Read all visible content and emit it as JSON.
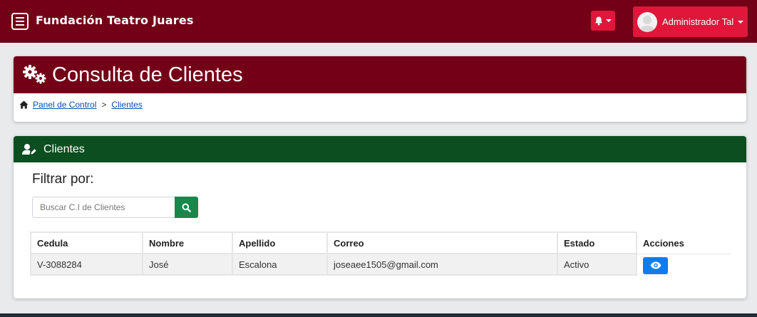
{
  "navbar": {
    "brand": "Fundación Teatro Juares",
    "user_name": "Administrador Tal",
    "menu_icon": "hamburger-menu-icon",
    "notifications_icon": "bell-icon",
    "colors": {
      "bar": "#730017",
      "button": "#e0163b"
    }
  },
  "page": {
    "title": "Consulta de Clientes",
    "title_icon": "gears-icon",
    "breadcrumb": {
      "home_icon": "home-icon",
      "items": [
        "Panel de Control",
        "Clientes"
      ],
      "separator": ">"
    }
  },
  "clients_panel": {
    "header": "Clientes",
    "header_icon": "user-edit-icon",
    "header_color": "#0c4e20",
    "filter_label": "Filtrar por:",
    "search": {
      "placeholder": "Buscar C.I de Clientes",
      "value": "",
      "button_icon": "search-icon",
      "button_color": "#17874a"
    },
    "table": {
      "columns": [
        "Cedula",
        "Nombre",
        "Apellido",
        "Correo",
        "Estado",
        "Acciones"
      ],
      "rows": [
        {
          "cedula": "V-3088284",
          "nombre": "José",
          "apellido": "Escalona",
          "correo": "joseaee1505@gmail.com",
          "estado": "Activo",
          "action_icon": "eye-icon"
        }
      ]
    }
  }
}
